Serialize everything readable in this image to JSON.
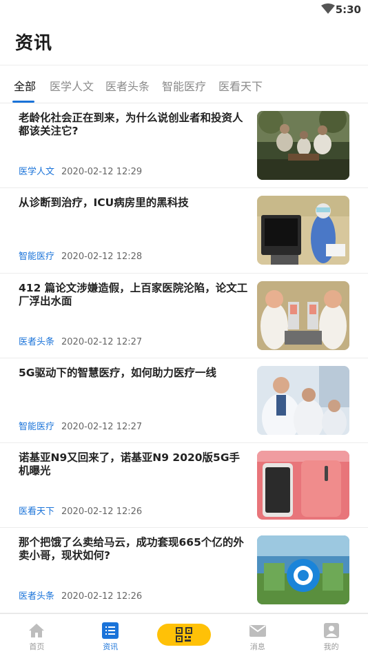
{
  "status_bar": {
    "time": "5:30"
  },
  "page": {
    "title": "资讯"
  },
  "tabs": [
    {
      "label": "全部",
      "active": true
    },
    {
      "label": "医学人文",
      "active": false
    },
    {
      "label": "医者头条",
      "active": false
    },
    {
      "label": "智能医疗",
      "active": false
    },
    {
      "label": "医看天下",
      "active": false
    }
  ],
  "news": [
    {
      "title": "老龄化社会正在到来，为什么说创业者和投资人都该关注它?",
      "category": "医学人文",
      "time": "2020-02-12 12:29",
      "thumb": "elderly-chess-photo"
    },
    {
      "title": "从诊断到治疗，ICU病房里的黑科技",
      "category": "智能医疗",
      "time": "2020-02-12 12:28",
      "thumb": "icu-device-photo"
    },
    {
      "title": "412 篇论文涉嫌造假，上百家医院沦陷，论文工厂浮出水面",
      "category": "医者头条",
      "time": "2020-02-12 12:27",
      "thumb": "cartoon-doctors-illustration"
    },
    {
      "title": "5G驱动下的智慧医疗，如何助力医疗一线",
      "category": "智能医疗",
      "time": "2020-02-12 12:27",
      "thumb": "doctors-team-photo"
    },
    {
      "title": "诺基亚N9又回来了，诺基亚N9 2020版5G手机曝光",
      "category": "医看天下",
      "time": "2020-02-12 12:26",
      "thumb": "pink-phone-photo"
    },
    {
      "title": "那个把饿了么卖给马云，成功套现665个亿的外卖小哥，现状如何?",
      "category": "医者头条",
      "time": "2020-02-12 12:26",
      "thumb": "eleme-building-photo"
    }
  ],
  "bottom_nav": [
    {
      "label": "首页",
      "icon": "home-icon",
      "active": false
    },
    {
      "label": "资讯",
      "icon": "list-icon",
      "active": true
    },
    {
      "label": "",
      "icon": "qr-code-icon",
      "active": false
    },
    {
      "label": "消息",
      "icon": "mail-icon",
      "active": false
    },
    {
      "label": "我的",
      "icon": "profile-icon",
      "active": false
    }
  ],
  "colors": {
    "accent": "#1a73d9",
    "scan_button": "#ffc107"
  }
}
